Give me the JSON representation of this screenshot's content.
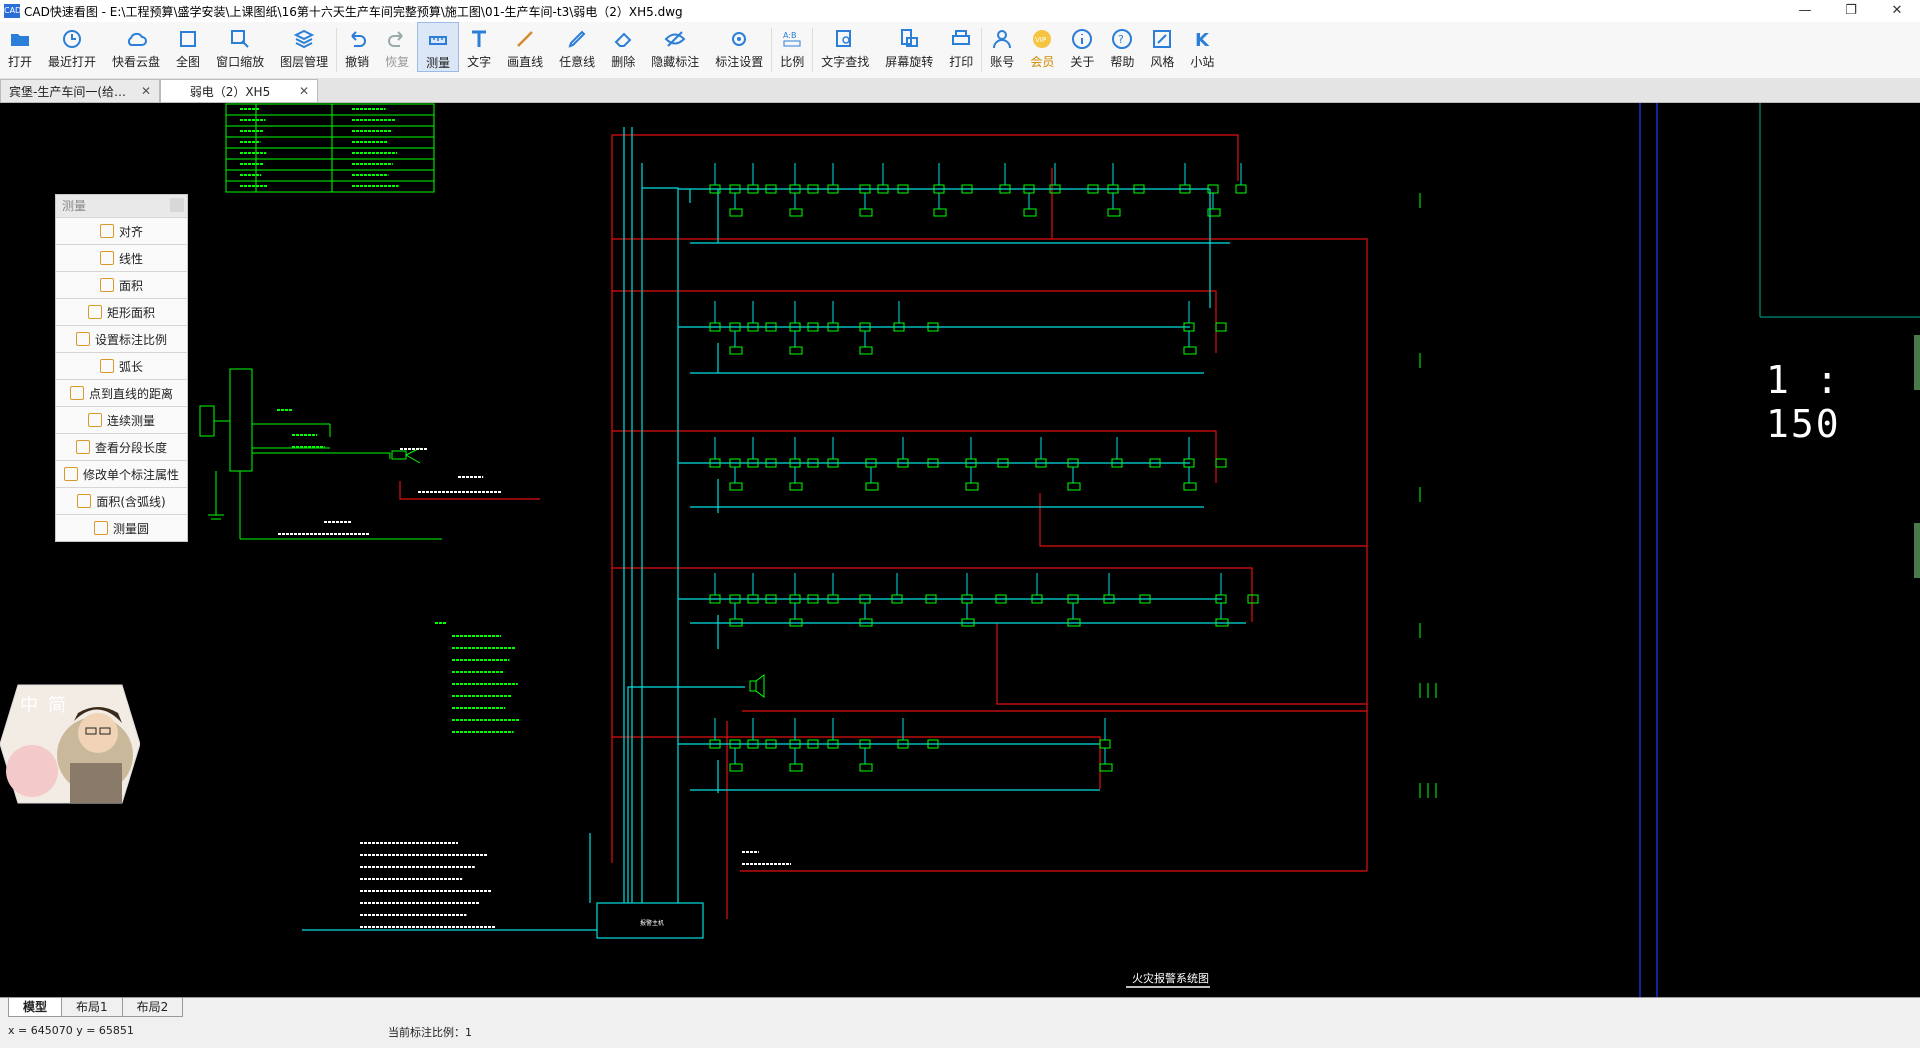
{
  "window": {
    "icon_text": "CAD",
    "title": "CAD快速看图 - E:\\工程预算\\盛学安装\\上课图纸\\16第十六天生产车间完整预算\\施工图\\01-生产车间-t3\\弱电（2）XH5.dwg",
    "min": "—",
    "max": "❐",
    "close": "✕"
  },
  "toolbar": {
    "items": [
      {
        "id": "open",
        "label": "打开",
        "icon": "folder-open-icon",
        "color": "#2b7fd8"
      },
      {
        "id": "recent",
        "label": "最近打开",
        "icon": "clock-icon",
        "color": "#2b7fd8"
      },
      {
        "id": "cloud",
        "label": "快看云盘",
        "icon": "cloud-icon",
        "color": "#2b7fd8"
      },
      {
        "id": "fullview",
        "label": "全图",
        "icon": "fullscreen-icon",
        "color": "#2b7fd8"
      },
      {
        "id": "zoomwin",
        "label": "窗口缩放",
        "icon": "zoom-window-icon",
        "color": "#2b7fd8"
      },
      {
        "id": "layers",
        "label": "图层管理",
        "icon": "layers-icon",
        "color": "#2b7fd8"
      },
      {
        "id": "undo",
        "label": "撤销",
        "icon": "undo-icon",
        "color": "#2b7fd8"
      },
      {
        "id": "redo",
        "label": "恢复",
        "icon": "redo-icon",
        "color": "#9aa"
      },
      {
        "id": "measure",
        "label": "测量",
        "icon": "ruler-icon",
        "color": "#2b7fd8"
      },
      {
        "id": "text",
        "label": "文字",
        "icon": "text-icon",
        "color": "#2b7fd8"
      },
      {
        "id": "line",
        "label": "画直线",
        "icon": "line-icon",
        "color": "#d88a2b"
      },
      {
        "id": "freeline",
        "label": "任意线",
        "icon": "pen-icon",
        "color": "#2b7fd8"
      },
      {
        "id": "erase",
        "label": "删除",
        "icon": "eraser-icon",
        "color": "#2b7fd8"
      },
      {
        "id": "hidemark",
        "label": "隐藏标注",
        "icon": "eye-icon",
        "color": "#2b7fd8"
      },
      {
        "id": "marksettings",
        "label": "标注设置",
        "icon": "mark-settings-icon",
        "color": "#2b7fd8"
      },
      {
        "id": "scale",
        "label": "比例",
        "icon": "scale-icon",
        "color": "#2b7fd8"
      },
      {
        "id": "findtext",
        "label": "文字查找",
        "icon": "find-text-icon",
        "color": "#2b7fd8"
      },
      {
        "id": "rotate",
        "label": "屏幕旋转",
        "icon": "rotate-icon",
        "color": "#2b7fd8"
      },
      {
        "id": "print",
        "label": "打印",
        "icon": "printer-icon",
        "color": "#2b7fd8"
      },
      {
        "id": "account",
        "label": "账号",
        "icon": "user-icon",
        "color": "#2b7fd8"
      },
      {
        "id": "vip",
        "label": "会员",
        "icon": "vip-icon",
        "color": "#d08a00"
      },
      {
        "id": "about",
        "label": "关于",
        "icon": "info-icon",
        "color": "#2b7fd8"
      },
      {
        "id": "help",
        "label": "帮助",
        "icon": "help-icon",
        "color": "#2b7fd8"
      },
      {
        "id": "style",
        "label": "风格",
        "icon": "style-icon",
        "color": "#2b7fd8"
      },
      {
        "id": "station",
        "label": "小站",
        "icon": "k-icon",
        "color": "#2b7fd8"
      }
    ]
  },
  "tabs": [
    {
      "label": "宾堡-生产车间一(给…",
      "close": "✕",
      "active": false
    },
    {
      "label": "弱电（2）XH5",
      "close": "✕",
      "active": true
    }
  ],
  "measure_panel": {
    "title": "测量",
    "items": [
      "对齐",
      "线性",
      "面积",
      "矩形面积",
      "设置标注比例",
      "弧长",
      "点到直线的距离",
      "连续测量",
      "查看分段长度",
      "修改单个标注属性",
      "面积(含弧线)",
      "测量圆"
    ]
  },
  "drawing": {
    "scale_label": "1 : 150",
    "caption": "火灾报警系统图",
    "bottom_box": "报警主机"
  },
  "avatar": {
    "text1": "中",
    "text2": "简"
  },
  "layout_tabs": [
    "模型",
    "布局1",
    "布局2"
  ],
  "status": {
    "coords": "x = 645070  y = 65851",
    "scale": "当前标注比例：1"
  }
}
